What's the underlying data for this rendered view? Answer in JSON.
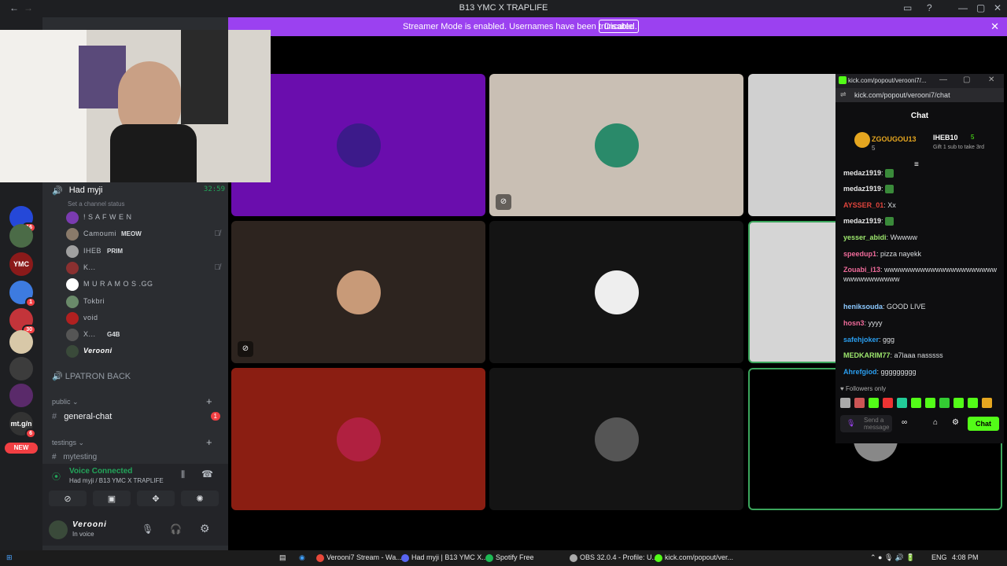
{
  "window": {
    "title": "B13 YMC X TRAPLIFE"
  },
  "banner": {
    "text": "Streamer Mode is enabled. Usernames have been truncated.",
    "disable_label": "Disable"
  },
  "servers": [
    {
      "name": "",
      "badge": "",
      "color": "#4a6cf7"
    },
    {
      "name": "",
      "badge": "16",
      "color": "#2548d8"
    },
    {
      "name": "",
      "badge": "",
      "color": "#4b6b47"
    },
    {
      "name": "YMC",
      "badge": "",
      "color": "#8b1a1a"
    },
    {
      "name": "",
      "badge": "1",
      "color": "#3d7be0"
    },
    {
      "name": "",
      "badge": "30",
      "color": "#c3343a"
    },
    {
      "name": "",
      "badge": "",
      "color": "#d8c8a8"
    },
    {
      "name": "",
      "badge": "",
      "color": "#3c3c3c"
    },
    {
      "name": "",
      "badge": "",
      "color": "#5a2a6a"
    },
    {
      "name": "mt.g/n",
      "badge": "6",
      "color": "#333"
    }
  ],
  "new_label": "NEW",
  "voice_channel": {
    "name": "Had myji",
    "timer": "32:59",
    "status_placeholder": "Set a channel status",
    "members": [
      {
        "name": "! S A F W E N",
        "tag": "",
        "muted": false,
        "color": "#7a3bb0"
      },
      {
        "name": "Camoumi",
        "tag": "MEOW",
        "muted": true,
        "color": "#8a7a6a"
      },
      {
        "name": "IHEB",
        "tag": "PRIM",
        "muted": false,
        "color": "#a0a0a0"
      },
      {
        "name": "K...",
        "tag": "",
        "muted": true,
        "color": "#8a3030"
      },
      {
        "name": "M U R A M O S .GG",
        "tag": "",
        "muted": false,
        "color": "#ffffff"
      },
      {
        "name": "Tokbri",
        "tag": "",
        "muted": false,
        "color": "#6a8a6a"
      },
      {
        "name": "void",
        "tag": "",
        "muted": false,
        "color": "#b02020"
      },
      {
        "name": "X...",
        "tag": "G4B",
        "muted": false,
        "color": "#555"
      },
      {
        "name": "Verooni",
        "tag": "",
        "muted": false,
        "color": "#3a4a3a"
      }
    ]
  },
  "other_channels": {
    "lpatron": "LPATRON BACK",
    "public_section": "public",
    "general_chat": "general-chat",
    "general_badge": "1",
    "testings_section": "testings",
    "mytesting": "mytesting"
  },
  "voice_panel": {
    "status": "Voice Connected",
    "location": "Had myji / B13 YMC X TRAPLIFE"
  },
  "user_panel": {
    "name": "Verooni",
    "status": "In voice"
  },
  "tiles": [
    {
      "bg": "#6a0dad",
      "avatar": "#3c1a8a",
      "muted": false
    },
    {
      "bg": "#c9bfb4",
      "avatar": "#2a8a6a",
      "muted": true
    },
    {
      "bg": "#d0d0d0",
      "avatar": "",
      "muted": false
    },
    {
      "bg": "#2d241f",
      "avatar": "#c89a78",
      "muted": true
    },
    {
      "bg": "#141414",
      "avatar": "#eeeeee",
      "muted": false
    },
    {
      "bg": "#d5d5d5",
      "avatar": "",
      "muted": false
    },
    {
      "bg": "#8b1e12",
      "avatar": "#b02040",
      "muted": false
    },
    {
      "bg": "#141414",
      "avatar": "#555555",
      "muted": false
    },
    {
      "bg": "#000000",
      "avatar": "#888888",
      "muted": false
    }
  ],
  "chat": {
    "window_title": "kick.com/popout/verooni7/...",
    "url": "kick.com/popout/verooni7/chat",
    "header": "Chat",
    "pinned": [
      {
        "name": "ZGOUGOU13",
        "count": "5"
      },
      {
        "name": "IHEB10",
        "count": "5",
        "note": "Gift 1 sub to take 3rd"
      }
    ],
    "messages": [
      {
        "user": "medaz1919",
        "color": "#e8e8e8",
        "text": ""
      },
      {
        "user": "medaz1919",
        "color": "#e8e8e8",
        "text": ""
      },
      {
        "user": "AYSSER_01",
        "color": "#e0443c",
        "text": "Xx"
      },
      {
        "user": "medaz1919",
        "color": "#e8e8e8",
        "text": ""
      },
      {
        "user": "yesser_abidi",
        "color": "#9ee86e",
        "text": "Wwwww"
      },
      {
        "user": "speedup1",
        "color": "#f06b9b",
        "text": "pizza nayekk"
      },
      {
        "user": "Zouabi_i13",
        "color": "#f06b9b",
        "text": "wwwwwwwwwwwwwwwwwwwwwwwwwwwwwwwww"
      },
      {
        "user": "heniksouda",
        "color": "#8bc8ff",
        "text": "GOOD LIVE"
      },
      {
        "user": "hosn3",
        "color": "#f06b9b",
        "text": "yyyy"
      },
      {
        "user": "safehjoker",
        "color": "#2a9ef0",
        "text": "ggg"
      },
      {
        "user": "MEDKARIM77",
        "color": "#9ee86e",
        "text": "a7laaa nasssss"
      },
      {
        "user": "Ahrefgiod",
        "color": "#2a9ef0",
        "text": "ggggggggg"
      }
    ],
    "followers_only": "Followers only",
    "input_placeholder": "Send a message",
    "send_label": "Chat"
  },
  "taskbar": {
    "items": [
      "Verooni7 Stream - Wa...",
      "Had myji | B13 YMC X...",
      "Spotify Free",
      "OBS 32.0.4 - Profile: U...",
      "kick.com/popout/ver..."
    ],
    "lang": "ENG",
    "time": "4:08 PM"
  }
}
